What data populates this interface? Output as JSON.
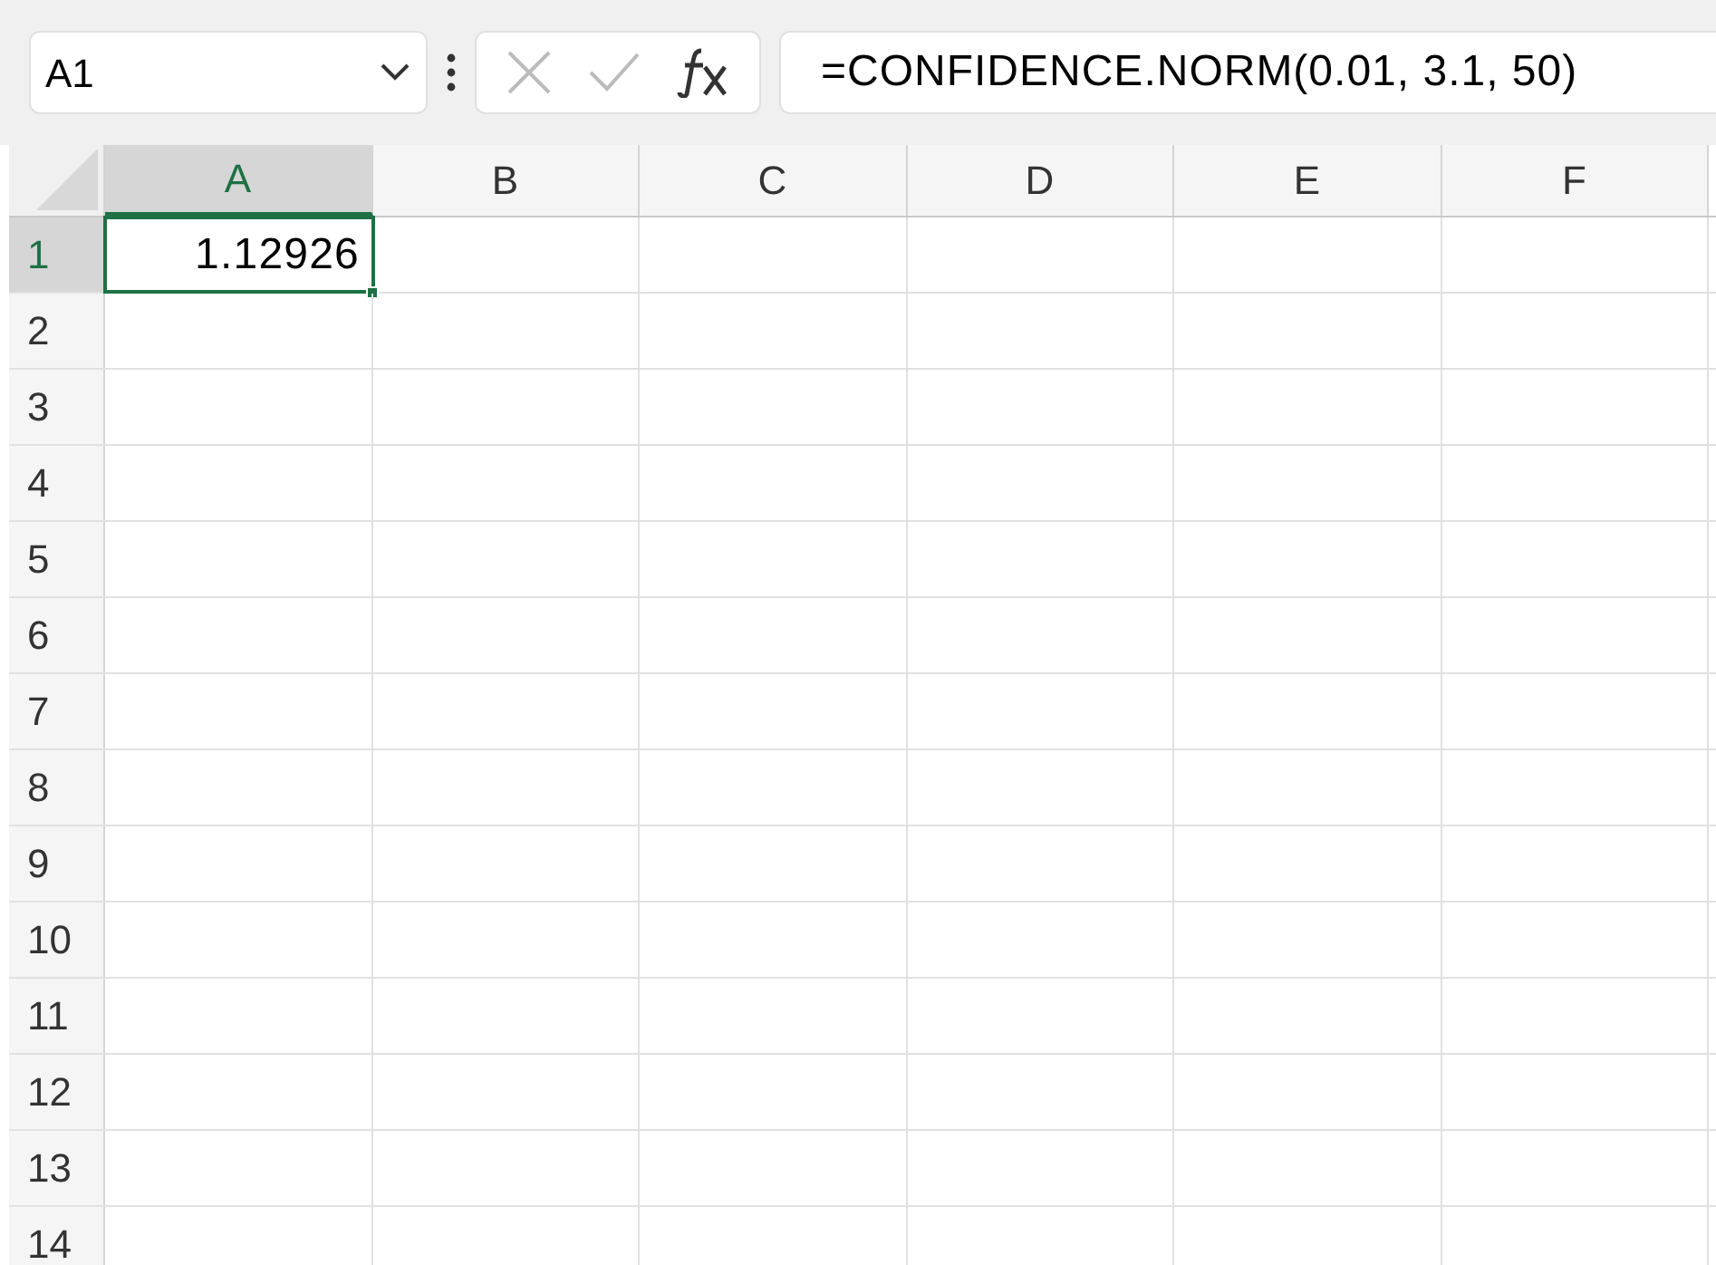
{
  "name_box": {
    "value": "A1"
  },
  "formula_bar": {
    "value": "=CONFIDENCE.NORM(0.01, 3.1, 50)"
  },
  "columns": [
    {
      "label": "A",
      "selected": true
    },
    {
      "label": "B",
      "selected": false
    },
    {
      "label": "C",
      "selected": false
    },
    {
      "label": "D",
      "selected": false
    },
    {
      "label": "E",
      "selected": false
    },
    {
      "label": "F",
      "selected": false
    }
  ],
  "rows": [
    {
      "label": "1",
      "selected": true,
      "cells": [
        {
          "value": "1.12926",
          "selected": true
        }
      ]
    },
    {
      "label": "2",
      "selected": false
    },
    {
      "label": "3",
      "selected": false
    },
    {
      "label": "4",
      "selected": false
    },
    {
      "label": "5",
      "selected": false
    },
    {
      "label": "6",
      "selected": false
    },
    {
      "label": "7",
      "selected": false
    },
    {
      "label": "8",
      "selected": false
    },
    {
      "label": "9",
      "selected": false
    },
    {
      "label": "10",
      "selected": false
    },
    {
      "label": "11",
      "selected": false
    },
    {
      "label": "12",
      "selected": false
    },
    {
      "label": "13",
      "selected": false
    },
    {
      "label": "14",
      "selected": false
    }
  ]
}
